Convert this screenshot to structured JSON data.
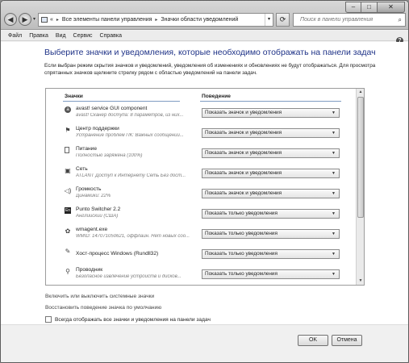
{
  "titlebar": {
    "minimize": "–",
    "maximize": "□",
    "close": "✕"
  },
  "nav": {
    "back_icon": "arrow-left-icon",
    "forward_icon": "arrow-right-icon",
    "dropdown": "▾"
  },
  "address": {
    "root_glyph": "«",
    "crumb1": "Все элементы панели управления",
    "crumb2": "Значки области уведомлений",
    "sep": "▸"
  },
  "search": {
    "placeholder": "Поиск в панели управления"
  },
  "menu": {
    "items": [
      "Файл",
      "Правка",
      "Вид",
      "Сервис",
      "Справка"
    ]
  },
  "main": {
    "title": "Выберите значки и уведомления, которые необходимо отображать на панели задач",
    "description": "Если выбран режим скрытия значков и уведомлений, уведомления об изменениях и обновлениях не будут отображаться. Для просмотра спрятанных значков щелкните стрелку рядом с областью уведомлений на панели задач."
  },
  "list": {
    "col_icons": "Значки",
    "col_behavior": "Поведение",
    "rows": [
      {
        "name": "avast! service GUI component",
        "sub": "avast! Сканер доступа: 8 параметров, из них...",
        "behavior": "Показать значок и уведомления"
      },
      {
        "name": "Центр поддержки",
        "sub": "Устранение проблем ПК: Важных сообщений...",
        "behavior": "Показать значок и уведомления"
      },
      {
        "name": "Питание",
        "sub": "Полностью заряжена (100%)",
        "behavior": "Показать значок и уведомления"
      },
      {
        "name": "Сеть",
        "sub": "ATLANT Доступ к Интернету Сеть Без дост...",
        "behavior": "Показать значок и уведомления"
      },
      {
        "name": "Громкость",
        "sub": "Динамики: 22%",
        "behavior": "Показать значок и уведомления"
      },
      {
        "name": "Punto Switcher 2.2",
        "sub": "Английский (США)",
        "behavior": "Показать только уведомления"
      },
      {
        "name": "wmagent.exe",
        "sub": "WMID: 147071050621, оффлайн. Нет новых соо...",
        "behavior": "Показать только уведомления"
      },
      {
        "name": "Хост-процесс Windows (Rundll32)",
        "sub": "",
        "behavior": "Показать только уведомления"
      },
      {
        "name": "Проводник",
        "sub": "Безопасное извлечение устройств и дисков...",
        "behavior": "Показать только уведомления"
      }
    ]
  },
  "links": {
    "system_icons": "Включить или выключить системные значки",
    "restore": "Восстановить поведение значка по умолчанию"
  },
  "checkbox": {
    "label": "Всегда отображать все значки и уведомления на панели задач"
  },
  "footer": {
    "ok": "OK",
    "cancel": "Отмена"
  }
}
